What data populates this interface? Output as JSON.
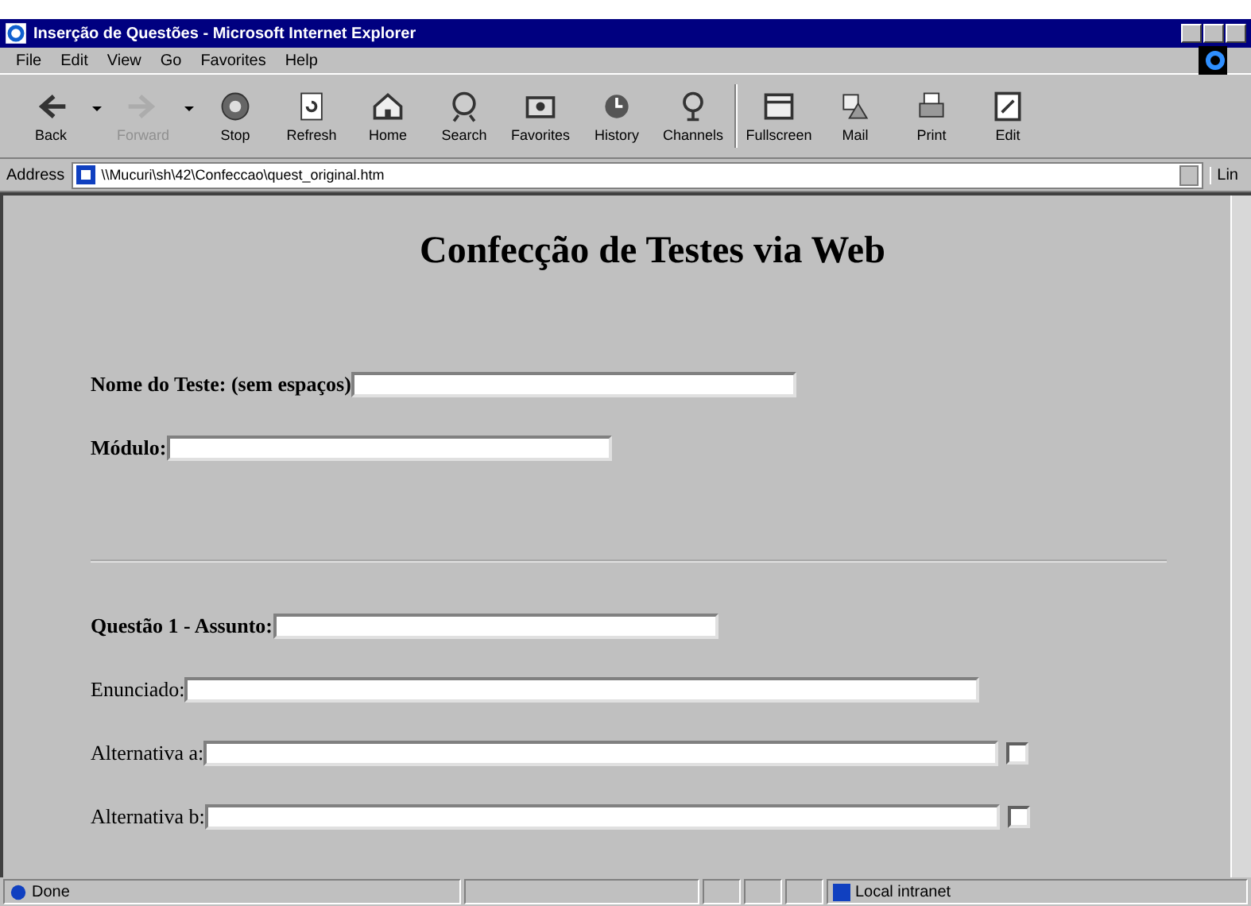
{
  "window": {
    "title": "Inserção de Questões - Microsoft Internet Explorer"
  },
  "menu": [
    "File",
    "Edit",
    "View",
    "Go",
    "Favorites",
    "Help"
  ],
  "toolbar": [
    {
      "label": "Back",
      "kind": "back",
      "disabled": false
    },
    {
      "label": "Forward",
      "kind": "forward",
      "disabled": true
    },
    {
      "label": "Stop",
      "kind": "stop",
      "disabled": false
    },
    {
      "label": "Refresh",
      "kind": "refresh",
      "disabled": false
    },
    {
      "label": "Home",
      "kind": "home",
      "disabled": false
    },
    {
      "label": "Search",
      "kind": "search",
      "disabled": false
    },
    {
      "label": "Favorites",
      "kind": "favorites",
      "disabled": false
    },
    {
      "label": "History",
      "kind": "history",
      "disabled": false
    },
    {
      "label": "Channels",
      "kind": "channels",
      "disabled": false
    },
    {
      "label": "Fullscreen",
      "kind": "fullscreen",
      "disabled": false
    },
    {
      "label": "Mail",
      "kind": "mail",
      "disabled": false
    },
    {
      "label": "Print",
      "kind": "print",
      "disabled": false
    },
    {
      "label": "Edit",
      "kind": "edit",
      "disabled": false
    }
  ],
  "address_bar": {
    "label": "Address",
    "value": "\\\\Mucuri\\sh\\42\\Confeccao\\quest_original.htm",
    "links": "Lin"
  },
  "page": {
    "heading": "Confecção de Testes via Web",
    "test_fields": [
      {
        "label": "Nome do Teste: (sem espaços)",
        "bold": true
      },
      {
        "label": "Módulo:",
        "bold": true
      }
    ],
    "question_fields": [
      {
        "label": "Questão 1 - Assunto:",
        "bold": true,
        "kind": "text"
      },
      {
        "label": "Enunciado:",
        "bold": false,
        "kind": "text"
      },
      {
        "label": "Alternativa a:",
        "bold": false,
        "kind": "alternative",
        "checked": false
      },
      {
        "label": "Alternativa b:",
        "bold": false,
        "kind": "alternative",
        "checked": false
      }
    ]
  },
  "status_bar": {
    "text": "Done",
    "zone": "Local intranet"
  }
}
